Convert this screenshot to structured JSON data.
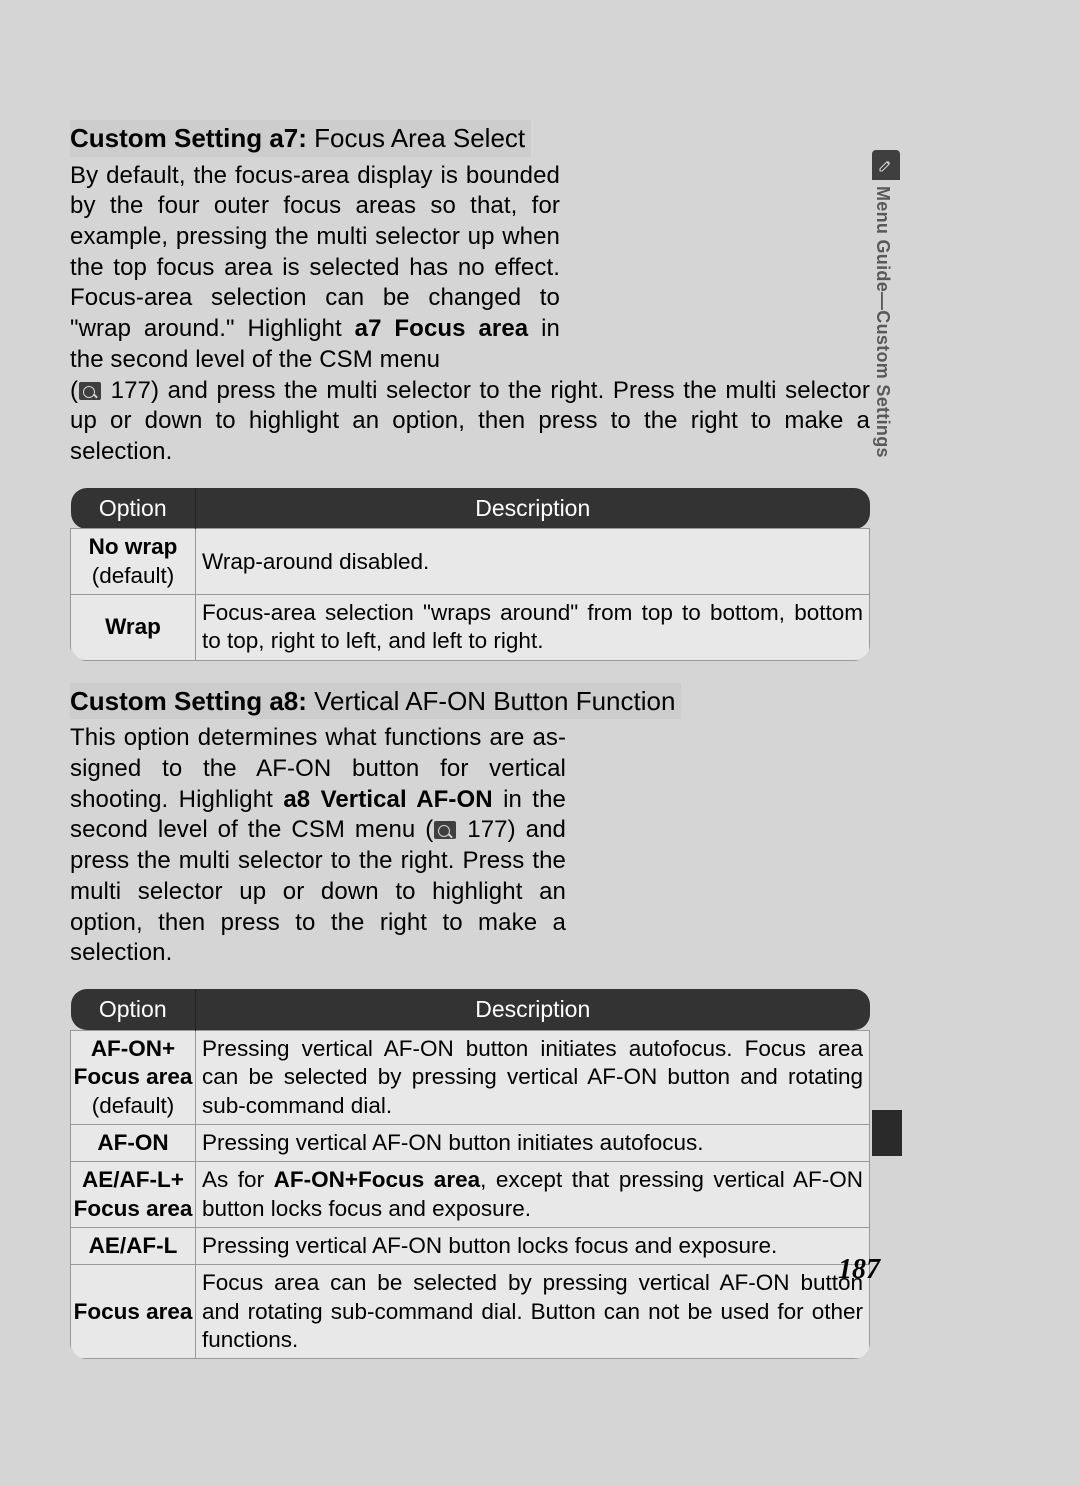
{
  "side_tab": {
    "icon_name": "pencil-icon",
    "label": "Menu Guide—Custom Settings"
  },
  "page_number": "187",
  "section_a7": {
    "heading_lead": "Custom Setting a7:",
    "heading_rest": " Focus Area Select",
    "para_narrow_1": "By default, the focus-area display is bounded by the four outer focus areas so that, for example, pressing the multi selector up when the top focus area is selected has no effect.  Focus-area selection can be changed to \"wrap around.\"  Highlight ",
    "para_narrow_bold1": "a7 Focus area",
    "para_narrow_2": " in the second level of the CSM menu",
    "para_full_1": "(",
    "page_ref": " 177",
    "para_full_2": ") and press the multi selector to the right.  Press the multi selector up or down to highlight an option, then press to the right to make a selection.",
    "table": {
      "head_option": "Option",
      "head_desc": "Description",
      "rows": [
        {
          "opt_main": "No wrap",
          "opt_sub": "(default)",
          "desc": "Wrap-around disabled."
        },
        {
          "opt_main": "Wrap",
          "opt_sub": "",
          "desc": "Focus-area selection \"wraps around\" from top to bottom, bottom to top, right to left, and left to right."
        }
      ]
    }
  },
  "section_a8": {
    "heading_lead": "Custom Setting a8:",
    "heading_rest": " Vertical AF-ON Button Function",
    "para_narrow_1": "This option determines what functions are as­signed to the ",
    "afon_1": "AF-ON",
    "para_narrow_2": " button for vertical shooting. Highlight ",
    "para_narrow_bold1": "a8 Vertical AF-ON",
    "para_narrow_3": " in the second level of the CSM menu (",
    "page_ref": " 177",
    "para_narrow_4": ") and press the multi selector to the right.  Press the multi selector up or down to highlight an option, then press to the right to make a selection.",
    "table": {
      "head_option": "Option",
      "head_desc": "Description",
      "rows": [
        {
          "opt_main": "AF-ON+",
          "opt_main2": "Focus area",
          "opt_sub": "(default)",
          "desc_pre": "Pressing vertical ",
          "desc_af1": "AF-ON",
          "desc_mid": " button initiates autofocus.  Focus area can be selected by pressing vertical ",
          "desc_af2": "AF-ON",
          "desc_post": " button and rotating sub-command dial."
        },
        {
          "opt_main": "AF-ON",
          "desc_pre": "Pressing vertical ",
          "desc_af1": "AF-ON",
          "desc_post": " button initiates autofocus."
        },
        {
          "opt_main": "AE/AF-L+",
          "opt_main2": "Focus area",
          "desc_pre": "As for ",
          "desc_bold": "AF-ON+Focus area",
          "desc_mid": ", except that pressing vertical ",
          "desc_af1": "AF-ON",
          "desc_post": " button locks focus and exposure."
        },
        {
          "opt_main": "AE/AF-L",
          "desc_pre": "Pressing vertical ",
          "desc_af1": "AF-ON",
          "desc_post": " button locks focus and exposure."
        },
        {
          "opt_main": "Focus area",
          "desc_pre": "Focus area can be selected by pressing vertical ",
          "desc_af1": "AF-ON",
          "desc_post": " button and rotat­ing sub-command dial.  Button can not be used for other functions."
        }
      ]
    }
  }
}
